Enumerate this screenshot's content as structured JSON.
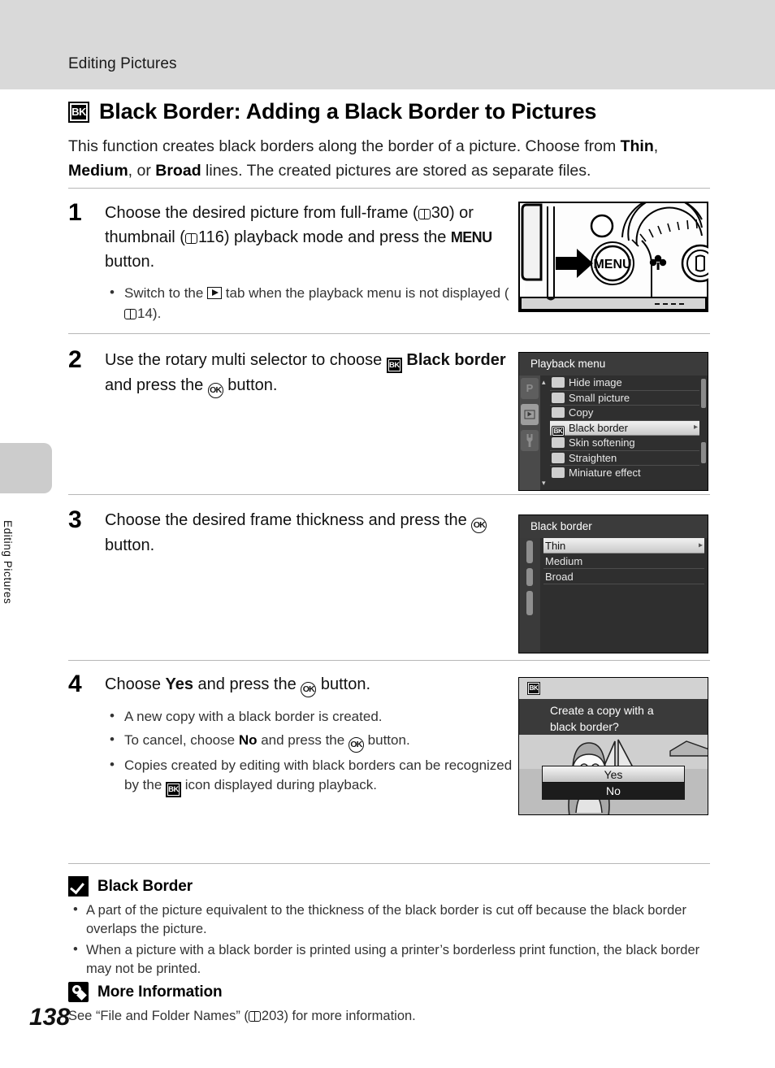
{
  "header": {
    "chapter_title": "Editing Pictures",
    "side_tab_text": "Editing Pictures",
    "page_number": "138"
  },
  "section": {
    "icon": "black-border-bk-icon",
    "title": "Black Border: Adding a Black Border to Pictures",
    "intro_part1": "This function creates black borders along the border of a picture. Choose from ",
    "intro_bold1": "Thin",
    "intro_sep1": ", ",
    "intro_bold2": "Medium",
    "intro_sep2": ", or ",
    "intro_bold3": "Broad",
    "intro_part2": " lines. The created pictures are stored as separate files."
  },
  "steps": [
    {
      "number": "1",
      "text_a": "Choose the desired picture from full-frame (",
      "ref_a": "30",
      "text_b": ") or thumbnail (",
      "ref_b": "116",
      "text_c": ") playback mode and press the ",
      "menu_label": "MENU",
      "text_d": " button.",
      "bullet_a": "Switch to the ",
      "bullet_b": " tab when the playback menu is not displayed (",
      "bullet_ref": "14",
      "bullet_c": ")."
    },
    {
      "number": "2",
      "text_a": "Use the rotary multi selector to choose ",
      "bold": "Black border",
      "text_b": " and press the ",
      "ok_label": "OK",
      "text_c": " button."
    },
    {
      "number": "3",
      "text_a": "Choose the desired frame thickness and press the ",
      "ok_label": "OK",
      "text_b": " button."
    },
    {
      "number": "4",
      "text_a": "Choose ",
      "bold_yes": "Yes",
      "text_b": " and press the ",
      "ok_label": "OK",
      "text_c": " button.",
      "bullets": [
        {
          "a": "A new copy with a black border is created."
        },
        {
          "a": "To cancel, choose ",
          "bold": "No",
          "b": " and press the ",
          "ok": "OK",
          "c": " button."
        },
        {
          "a": "Copies created by editing with black borders can be recognized by the ",
          "icon": "bk-icon",
          "c": " icon displayed during playback."
        }
      ]
    }
  ],
  "figures": {
    "camera": {
      "menu_button_label": "MENU",
      "alt": "camera-back-menu-button"
    },
    "playback_menu": {
      "title": "Playback menu",
      "tabs": [
        {
          "name": "shooting-tab",
          "label": "P",
          "selected": false
        },
        {
          "name": "playback-tab",
          "label": "",
          "selected": true
        },
        {
          "name": "setup-tab",
          "label": "",
          "selected": false
        }
      ],
      "items": [
        {
          "label": "Hide image",
          "selected": false,
          "icon": "hide-image-icon"
        },
        {
          "label": "Small picture",
          "selected": false,
          "icon": "small-picture-icon"
        },
        {
          "label": "Copy",
          "selected": false,
          "icon": "copy-icon"
        },
        {
          "label": "Black border",
          "selected": true,
          "icon": "black-border-icon",
          "submenu_arrow": "▸"
        },
        {
          "label": "Skin softening",
          "selected": false,
          "icon": "skin-softening-icon"
        },
        {
          "label": "Straighten",
          "selected": false,
          "icon": "straighten-icon"
        },
        {
          "label": "Miniature effect",
          "selected": false,
          "icon": "miniature-effect-icon"
        }
      ],
      "scroll_up": "▴",
      "scroll_down": "▾"
    },
    "black_border_menu": {
      "title": "Black border",
      "items": [
        {
          "label": "Thin",
          "selected": true,
          "submenu_arrow": "▸"
        },
        {
          "label": "Medium",
          "selected": false
        },
        {
          "label": "Broad",
          "selected": false
        }
      ]
    },
    "confirm_dialog": {
      "badge": "BK",
      "question_line1": "Create a copy with a",
      "question_line2": "black border?",
      "buttons": [
        {
          "label": "Yes",
          "selected": true
        },
        {
          "label": "No",
          "selected": false
        }
      ]
    }
  },
  "notes": {
    "caution": {
      "icon": "caution-check-icon",
      "title": "Black Border",
      "items": [
        "A part of the picture equivalent to the thickness of the black border is cut off because the black border overlaps the picture.",
        "When a picture with a black border is printed using a printer’s borderless print function, the black border may not be printed."
      ]
    },
    "more_info": {
      "icon": "more-information-bulb-icon",
      "title": "More Information",
      "text_a": "See “File and Folder Names” (",
      "ref": "203",
      "text_b": ") for more information."
    }
  }
}
